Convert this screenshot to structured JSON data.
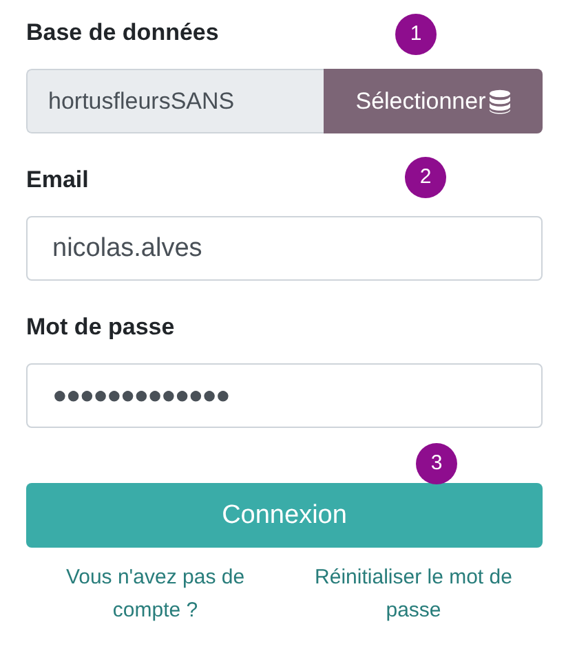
{
  "fields": [
    {
      "kind": "database",
      "label": "Base de données",
      "value": "hortusfleursSANS",
      "button": "Sélectionner",
      "marker": "1"
    },
    {
      "kind": "text",
      "label": "Email",
      "value": "nicolas.alves",
      "marker": "2"
    },
    {
      "kind": "password",
      "label": "Mot de passe",
      "value": "●●●●●●●●●●●●●"
    }
  ],
  "submit": {
    "label": "Connexion",
    "marker": "3"
  },
  "links": [
    "Vous n'avez pas de compte ?",
    "Réinitialiser le mot de passe"
  ]
}
